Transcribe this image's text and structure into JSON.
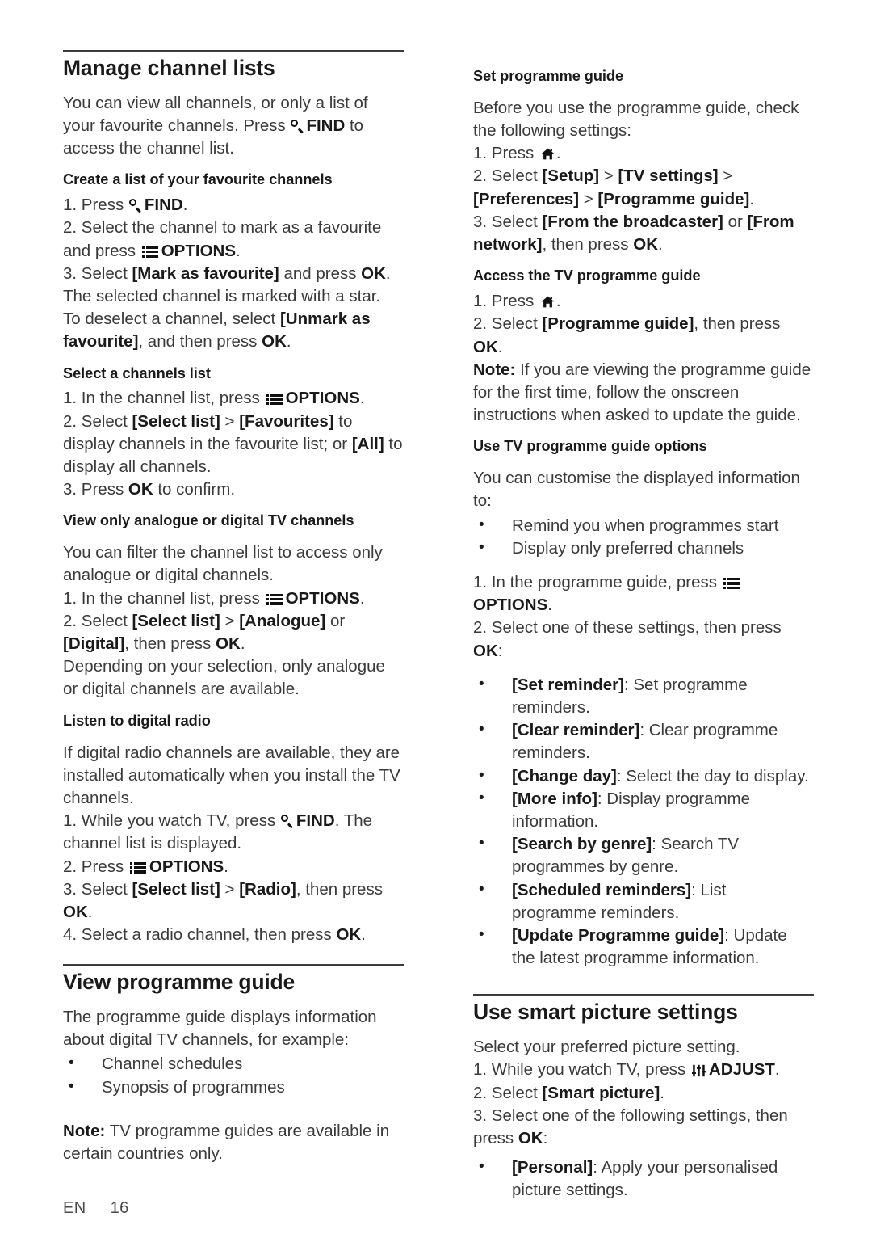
{
  "document": {
    "footer": {
      "language": "EN",
      "page_number": "16"
    }
  },
  "icons": {
    "find": "search-icon",
    "options": "options-list-icon",
    "home": "home-icon",
    "adjust": "adjust-sliders-icon"
  },
  "left_column": {
    "section1": {
      "title": "Manage channel lists",
      "intro_a": "You can view all channels, or only a list of your favourite channels. Press ",
      "intro_find": "FIND",
      "intro_b": " to access the channel list.",
      "sub1": {
        "heading": "Create a list of your favourite channels",
        "step1_a": "1. Press ",
        "step1_find": "FIND",
        "step1_b": ".",
        "step2_a": "2. Select the channel to mark as a favourite and press ",
        "step2_options": "OPTIONS",
        "step2_b": ".",
        "step3_a": "3. Select ",
        "step3_b": "[Mark as favourite]",
        "step3_c": " and press ",
        "step3_d": "OK",
        "step3_e": ".",
        "step3_note": "The selected channel is marked with a star.",
        "deselect_a": "To deselect a channel, select ",
        "deselect_b": "[Unmark as favourite]",
        "deselect_c": ", and then press ",
        "deselect_d": "OK",
        "deselect_e": "."
      },
      "sub2": {
        "heading": "Select a channels list",
        "step1_a": "1. In the channel list, press ",
        "step1_options": "OPTIONS",
        "step1_b": ".",
        "step2_a": "2. Select ",
        "step2_b": "[Select list]",
        "step2_c": " > ",
        "step2_d": "[Favourites]",
        "step2_e": " to display channels in the favourite list; or ",
        "step2_f": "[All]",
        "step2_g": " to display all channels.",
        "step3_a": "3. Press ",
        "step3_b": "OK",
        "step3_c": " to confirm."
      },
      "sub3": {
        "heading": "View only analogue or digital TV channels",
        "intro": "You can filter the channel list to access only analogue or digital channels.",
        "step1_a": "1. In the channel list, press ",
        "step1_options": "OPTIONS",
        "step1_b": ".",
        "step2_a": "2. Select ",
        "step2_b": "[Select list]",
        "step2_c": " > ",
        "step2_d": "[Analogue]",
        "step2_e": " or ",
        "step2_f": "[Digital]",
        "step2_g": ", then press ",
        "step2_h": "OK",
        "step2_i": ".",
        "outro": "Depending on your selection, only analogue or digital channels are available."
      },
      "sub4": {
        "heading": "Listen to digital radio",
        "intro": "If digital radio channels are available, they are installed automatically when you install the TV channels.",
        "step1_a": "1. While you watch TV, press ",
        "step1_find": "FIND",
        "step1_b": ". The channel list is displayed.",
        "step2_a": "2. Press ",
        "step2_options": "OPTIONS",
        "step2_b": ".",
        "step3_a": "3. Select ",
        "step3_b": "[Select list]",
        "step3_c": " > ",
        "step3_d": "[Radio]",
        "step3_e": ", then press ",
        "step3_f": "OK",
        "step3_g": ".",
        "step4_a": "4. Select a radio channel, then press ",
        "step4_b": "OK",
        "step4_c": "."
      }
    },
    "section2": {
      "title": "View programme guide",
      "intro": "The programme guide displays information about digital TV channels, for example:",
      "bullets": [
        "Channel schedules",
        "Synopsis of programmes"
      ],
      "note_label": "Note:",
      "note_text": " TV programme guides are available in certain countries only."
    }
  },
  "right_column": {
    "sub1": {
      "heading": "Set programme guide",
      "intro": "Before you use the programme guide, check the following settings:",
      "step1_a": "1. Press ",
      "step1_b": ".",
      "step2_a": "2. Select ",
      "step2_b": "[Setup]",
      "step2_c": " > ",
      "step2_d": "[TV settings]",
      "step2_e": " > ",
      "step2_f": "[Preferences]",
      "step2_g": " > ",
      "step2_h": "[Programme guide]",
      "step2_i": ".",
      "step3_a": "3. Select ",
      "step3_b": "[From the broadcaster]",
      "step3_c": " or ",
      "step3_d": "[From network]",
      "step3_e": ", then press ",
      "step3_f": "OK",
      "step3_g": "."
    },
    "sub2": {
      "heading": "Access the TV programme guide",
      "step1_a": "1. Press ",
      "step1_b": ".",
      "step2_a": "2. Select ",
      "step2_b": "[Programme guide]",
      "step2_c": ", then press ",
      "step2_d": "OK",
      "step2_e": ".",
      "note_label": "Note:",
      "note_text": " If you are viewing the programme guide for the first time, follow the onscreen instructions when asked to update the guide."
    },
    "sub3": {
      "heading": "Use TV programme guide options",
      "intro": "You can customise the displayed information to:",
      "bullets": [
        "Remind you when programmes start",
        "Display only preferred channels"
      ],
      "step1_a": "1. In the programme guide, press ",
      "step1_options": "OPTIONS",
      "step1_b": ".",
      "step2_a": "2. Select one of these settings, then press ",
      "step2_b": "OK",
      "step2_c": ":",
      "options": [
        {
          "term": "[Set reminder]",
          "desc": ": Set programme reminders."
        },
        {
          "term": "[Clear reminder]",
          "desc": ": Clear programme reminders."
        },
        {
          "term": "[Change day]",
          "desc": ": Select the day to display."
        },
        {
          "term": "[More info]",
          "desc": ": Display programme information."
        },
        {
          "term": "[Search by genre]",
          "desc": ": Search TV programmes by genre."
        },
        {
          "term": "[Scheduled reminders]",
          "desc": ": List programme reminders."
        },
        {
          "term": "[Update Programme guide]",
          "desc": ": Update the latest programme information."
        }
      ]
    },
    "section2": {
      "title": "Use smart picture settings",
      "intro": "Select your preferred picture setting.",
      "step1_a": "1. While you watch TV, press ",
      "step1_adjust": "ADJUST",
      "step1_b": ".",
      "step2_a": "2. Select ",
      "step2_b": "[Smart picture]",
      "step2_c": ".",
      "step3_a": "3. Select one of the following settings, then press ",
      "step3_b": "OK",
      "step3_c": ":",
      "options": [
        {
          "term": "[Personal]",
          "desc": ": Apply your personalised picture settings."
        }
      ]
    }
  }
}
